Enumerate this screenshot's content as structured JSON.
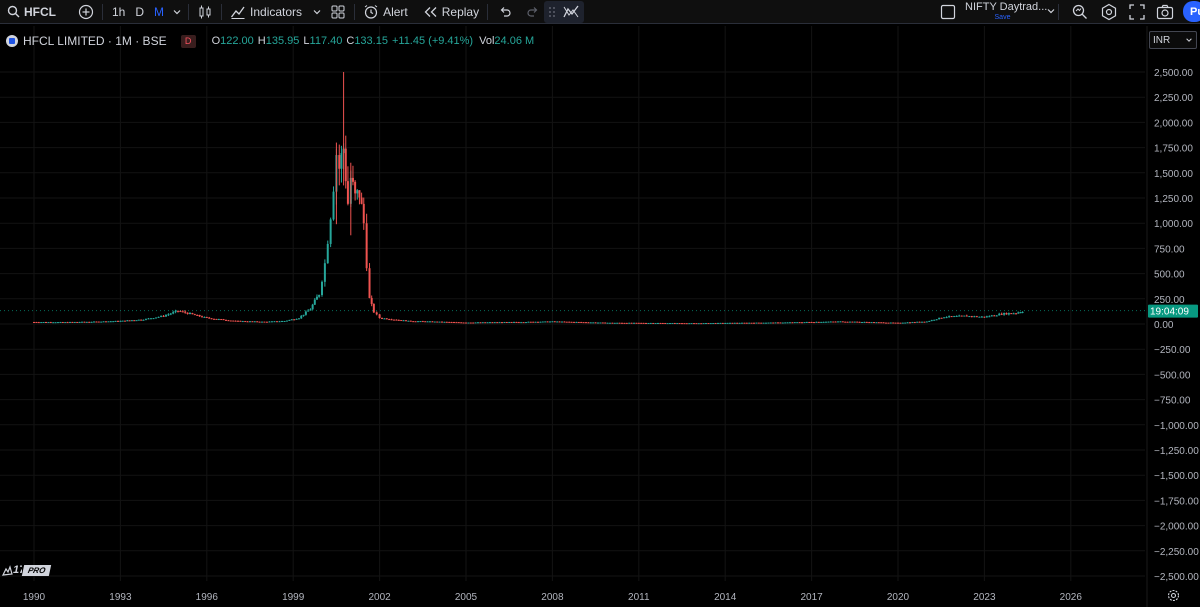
{
  "toolbar": {
    "symbol": "HFCL",
    "intervals": [
      "1h",
      "D",
      "M"
    ],
    "active_interval": "M",
    "indicators_label": "Indicators",
    "alert_label": "Alert",
    "replay_label": "Replay",
    "layout_name": "NIFTY Daytrad...",
    "layout_status": "Save",
    "publish_label": "Pu"
  },
  "legend": {
    "title": "HFCL LIMITED · 1M · BSE",
    "badge": "D",
    "o_label": "O",
    "o_value": "122.00",
    "h_label": "H",
    "h_value": "135.95",
    "l_label": "L",
    "l_value": "117.40",
    "c_label": "C",
    "c_value": "133.15",
    "change": "+11.45 (+9.41%)",
    "vol_label": "Vol",
    "vol_value": "24.06 M"
  },
  "price_scale": {
    "currency": "INR",
    "countdown": "19:04:09"
  },
  "colors": {
    "up": "#26a69a",
    "down": "#ef5350",
    "accent": "#2962ff",
    "price_label": "#089981"
  },
  "branding": {
    "badge": "PRO"
  },
  "icons": [
    "search-icon",
    "plus-circle-icon",
    "chevron-down-icon",
    "candles-icon",
    "indicators-icon",
    "templates-icon",
    "alert-clock-icon",
    "replay-icon",
    "undo-icon",
    "redo-icon",
    "drag-handle-icon",
    "layout-square-icon",
    "magnifier-icon",
    "settings-icon",
    "fullscreen-icon",
    "camera-icon",
    "gear-icon"
  ],
  "chart_data": {
    "type": "candlestick",
    "y_ticks": [
      "2,500.00",
      "2,250.00",
      "2,000.00",
      "1,750.00",
      "1,500.00",
      "1,250.00",
      "1,000.00",
      "750.00",
      "500.00",
      "250.00",
      "0.00",
      "−250.00",
      "−500.00",
      "−750.00",
      "−1,000.00",
      "−1,250.00",
      "−1,500.00",
      "−1,750.00",
      "−2,000.00",
      "−2,250.00",
      "−2,500.00"
    ],
    "x_ticks": [
      "1990",
      "1993",
      "1996",
      "1999",
      "2002",
      "2005",
      "2008",
      "2011",
      "2014",
      "2017",
      "2020",
      "2023",
      "2026"
    ],
    "ylim": [
      -2500,
      2500
    ],
    "last_price": 133.15,
    "series": [
      {
        "t": 1990.0,
        "c": 20
      },
      {
        "t": 1991.0,
        "c": 18
      },
      {
        "t": 1992.0,
        "c": 22
      },
      {
        "t": 1993.0,
        "c": 30
      },
      {
        "t": 1993.8,
        "c": 45
      },
      {
        "t": 1994.5,
        "c": 80
      },
      {
        "t": 1995.0,
        "c": 130
      },
      {
        "t": 1995.5,
        "c": 95
      },
      {
        "t": 1996.0,
        "c": 60
      },
      {
        "t": 1997.0,
        "c": 30
      },
      {
        "t": 1998.0,
        "c": 22
      },
      {
        "t": 1998.7,
        "c": 30
      },
      {
        "t": 1999.2,
        "c": 60
      },
      {
        "t": 1999.6,
        "c": 150
      },
      {
        "t": 1999.9,
        "c": 300
      },
      {
        "t": 2000.1,
        "c": 600
      },
      {
        "t": 2000.3,
        "c": 1100
      },
      {
        "t": 2000.5,
        "c": 1700
      },
      {
        "t": 2000.6,
        "c": 1550
      },
      {
        "t": 2000.75,
        "c": 1750
      },
      {
        "t": 2000.9,
        "c": 1200
      },
      {
        "t": 2001.0,
        "c": 1450
      },
      {
        "t": 2001.15,
        "c": 1250
      },
      {
        "t": 2001.3,
        "c": 1300
      },
      {
        "t": 2001.45,
        "c": 1000
      },
      {
        "t": 2001.55,
        "c": 600
      },
      {
        "t": 2001.65,
        "c": 250
      },
      {
        "t": 2001.8,
        "c": 120
      },
      {
        "t": 2002.0,
        "c": 60
      },
      {
        "t": 2003.0,
        "c": 30
      },
      {
        "t": 2005.0,
        "c": 15
      },
      {
        "t": 2007.0,
        "c": 20
      },
      {
        "t": 2008.0,
        "c": 25
      },
      {
        "t": 2010.0,
        "c": 12
      },
      {
        "t": 2013.0,
        "c": 8
      },
      {
        "t": 2016.0,
        "c": 15
      },
      {
        "t": 2018.0,
        "c": 25
      },
      {
        "t": 2020.0,
        "c": 12
      },
      {
        "t": 2021.0,
        "c": 25
      },
      {
        "t": 2021.6,
        "c": 70
      },
      {
        "t": 2022.3,
        "c": 80
      },
      {
        "t": 2023.0,
        "c": 70
      },
      {
        "t": 2023.6,
        "c": 100
      },
      {
        "t": 2024.1,
        "c": 110
      },
      {
        "t": 2024.4,
        "c": 133
      }
    ],
    "spike_highs": [
      {
        "t": 2000.75,
        "h": 2500
      },
      {
        "t": 2000.5,
        "h": 1800
      },
      {
        "t": 2001.0,
        "h": 1600
      }
    ]
  }
}
